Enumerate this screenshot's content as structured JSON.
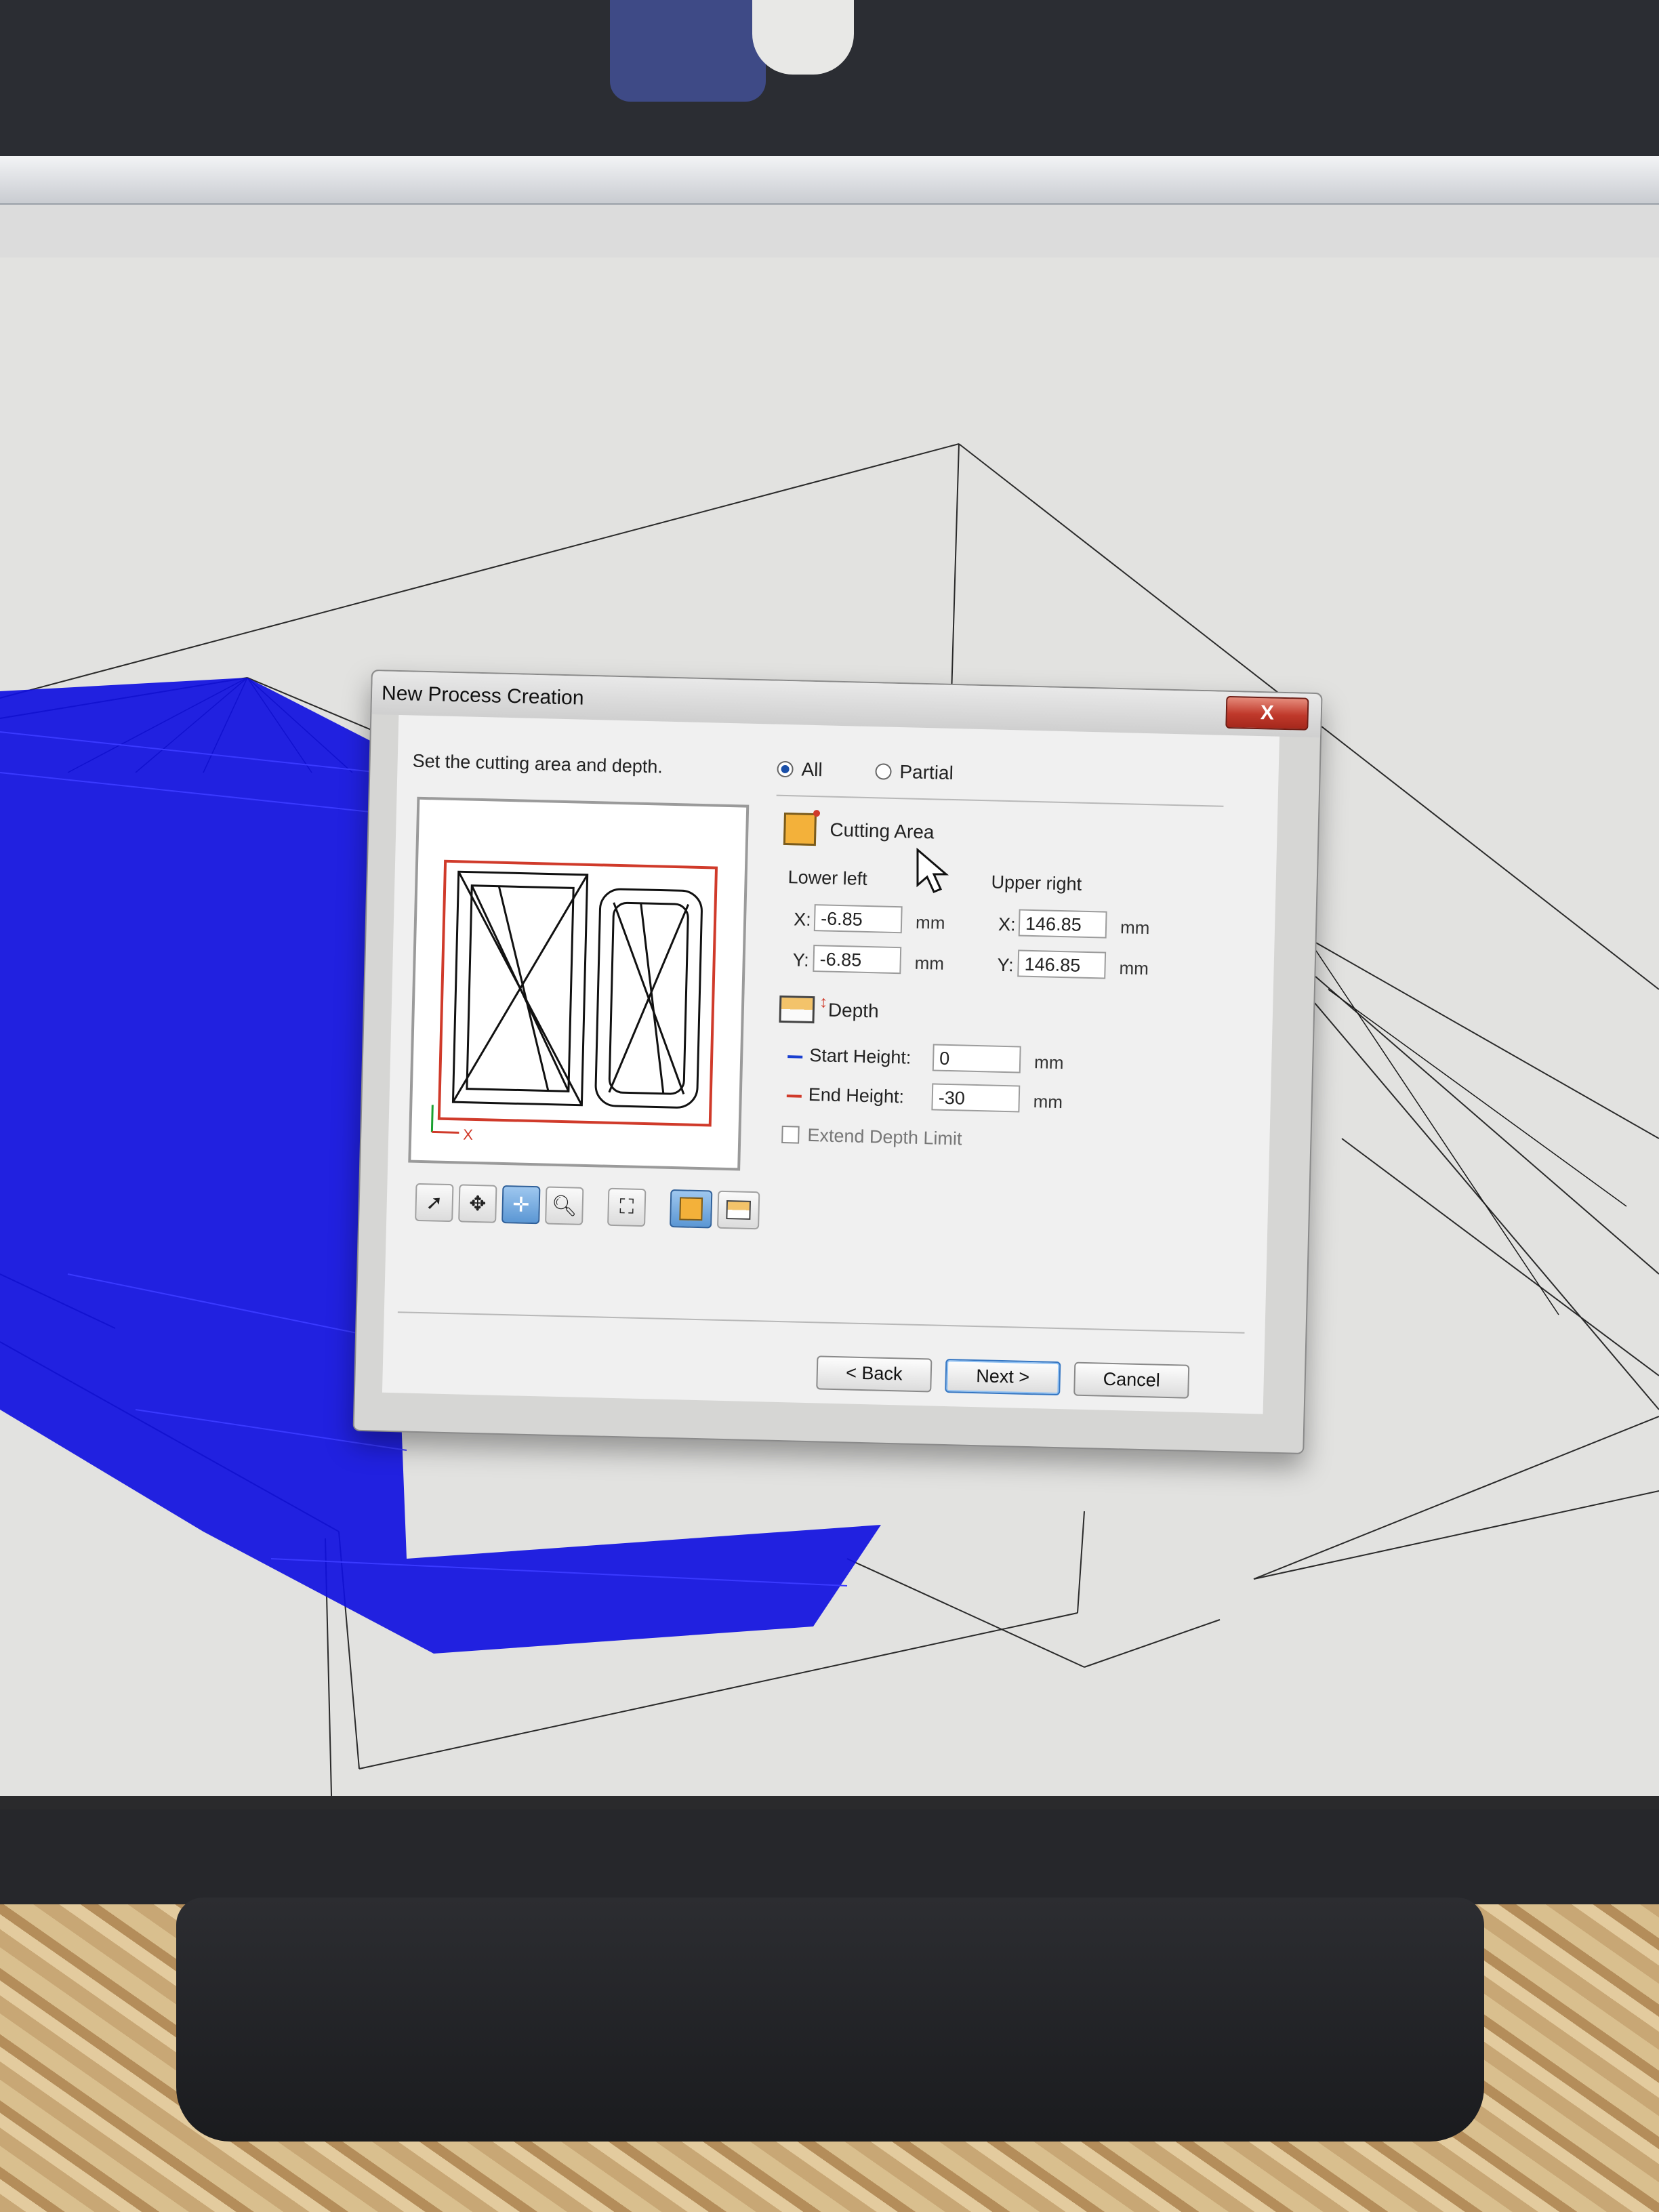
{
  "dialog": {
    "title": "New Process Creation",
    "close_label": "X",
    "prompt": "Set the cutting area and depth.",
    "scope_options": [
      {
        "label": "All",
        "selected": true
      },
      {
        "label": "Partial",
        "selected": false
      }
    ],
    "cutting_area": {
      "heading": "Cutting Area",
      "lower_left_label": "Lower left",
      "upper_right_label": "Upper right",
      "x_label": "X:",
      "y_label": "Y:",
      "lower_left_x": "-6.85",
      "lower_left_y": "-6.85",
      "upper_right_x": "146.85",
      "upper_right_y": "146.85",
      "unit": "mm"
    },
    "depth": {
      "heading": "Depth",
      "start_height_label": "Start Height:",
      "start_height": "0",
      "end_height_label": "End Height:",
      "end_height": "-30",
      "unit": "mm",
      "extend_label": "Extend Depth Limit",
      "extend_checked": false
    },
    "buttons": {
      "back": "< Back",
      "next": "Next >",
      "cancel": "Cancel"
    },
    "preview_axis_x": "X",
    "tools": [
      "select-arrow-icon",
      "pan-icon",
      "move-icon",
      "zoom-icon",
      "fit-icon",
      "cutting-area-icon",
      "depth-icon"
    ]
  },
  "colors": {
    "toolpath": "#1010e0",
    "area_box": "#d03a2a",
    "close_button": "#c0392b",
    "area_icon_fill": "#f3b13a"
  }
}
